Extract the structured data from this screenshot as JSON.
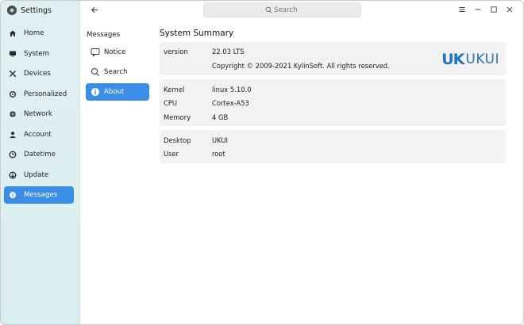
{
  "app": {
    "title": "Settings"
  },
  "sidebar": {
    "items": [
      {
        "label": "Home",
        "icon": "home-icon",
        "active": false
      },
      {
        "label": "System",
        "icon": "monitor-icon",
        "active": false
      },
      {
        "label": "Devices",
        "icon": "devices-icon",
        "active": false
      },
      {
        "label": "Personalized",
        "icon": "palette-icon",
        "active": false
      },
      {
        "label": "Network",
        "icon": "globe-icon",
        "active": false
      },
      {
        "label": "Account",
        "icon": "user-icon",
        "active": false
      },
      {
        "label": "Datetime",
        "icon": "clock-icon",
        "active": false
      },
      {
        "label": "Update",
        "icon": "update-icon",
        "active": false
      },
      {
        "label": "Messages",
        "icon": "info-icon",
        "active": true
      }
    ]
  },
  "search": {
    "placeholder": "Search",
    "value": ""
  },
  "section": {
    "title": "Messages",
    "items": [
      {
        "label": "Notice",
        "icon": "notice-icon",
        "active": false
      },
      {
        "label": "Search",
        "icon": "search-icon",
        "active": false
      },
      {
        "label": "About",
        "icon": "info-icon",
        "active": true
      }
    ]
  },
  "main": {
    "title": "System Summary",
    "version": {
      "label": "version",
      "value": "22.03 LTS",
      "copyright": "Copyright © 2009-2021 KylinSoft. All rights reserved."
    },
    "logo": {
      "bold": "UK",
      "light": "UKUI"
    },
    "hardware": [
      {
        "label": "Kernel",
        "value": "linux 5.10.0"
      },
      {
        "label": "CPU",
        "value": "Cortex-A53"
      },
      {
        "label": "Memory",
        "value": "4 GB"
      }
    ],
    "env": [
      {
        "label": "Desktop",
        "value": "UKUI"
      },
      {
        "label": "User",
        "value": "root"
      }
    ]
  },
  "colors": {
    "accent": "#3b8ee8",
    "sidebar_bg": "#dff0f2",
    "card_bg": "#f2f2f2",
    "logo_blue": "#1b74c7"
  }
}
